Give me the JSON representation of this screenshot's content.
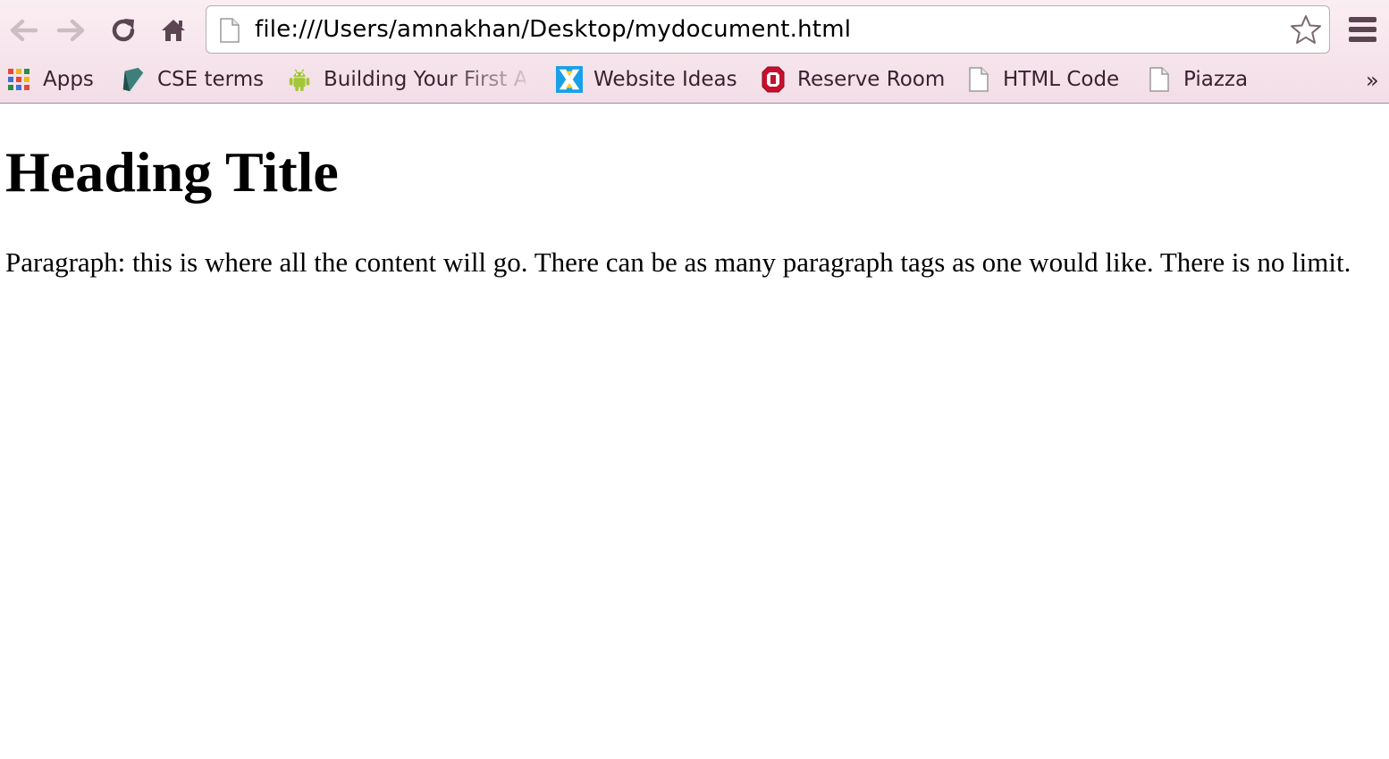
{
  "toolbar": {
    "url": "file:///Users/amnakhan/Desktop/mydocument.html"
  },
  "bookmarks": {
    "items": [
      {
        "label": "Apps",
        "icon": "apps-grid-icon"
      },
      {
        "label": "CSE terms",
        "icon": "book-icon"
      },
      {
        "label": "Building Your First A",
        "icon": "android-icon"
      },
      {
        "label": "Website Ideas",
        "icon": "website-ideas-icon"
      },
      {
        "label": "Reserve Room",
        "icon": "ohio-state-icon"
      },
      {
        "label": "HTML Code",
        "icon": "page-icon"
      },
      {
        "label": "Piazza",
        "icon": "page-icon"
      }
    ],
    "overflow": "»"
  },
  "page": {
    "heading": "Heading Title",
    "paragraph": "Paragraph: this is where all the content will go. There can be as many paragraph tags as one would like. There is no limit."
  },
  "colors": {
    "chrome_bg": "#f7e6ed",
    "text": "#3b2130",
    "nav_icon_inactive": "#c9b8bf",
    "nav_icon_active": "#5b4550"
  }
}
